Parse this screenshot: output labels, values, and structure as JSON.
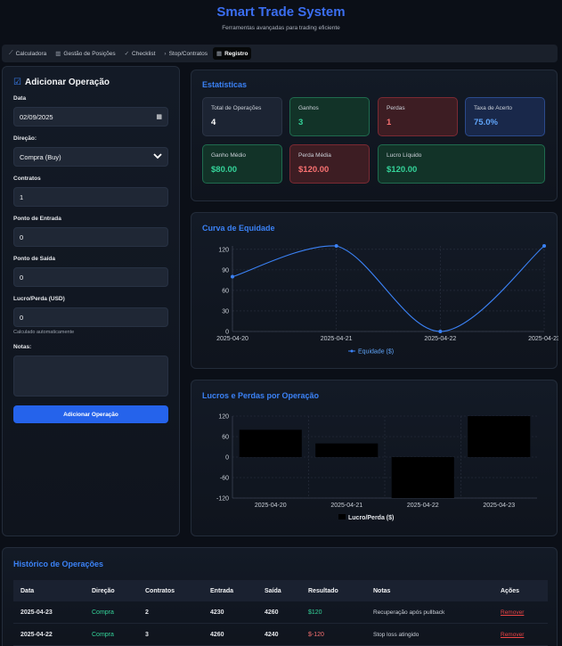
{
  "app": {
    "title": "Smart Trade System",
    "subtitle": "Ferramentas avançadas para trading eficiente"
  },
  "tabs": [
    {
      "label": "Calculadora",
      "icon": "trend-icon",
      "active": false
    },
    {
      "label": "Gestão de Posições",
      "icon": "bar-chart-icon",
      "active": false
    },
    {
      "label": "Checklist",
      "icon": "check-icon",
      "active": false
    },
    {
      "label": "Stop/Contratos",
      "icon": "chevron-icon",
      "active": false
    },
    {
      "label": "Registro",
      "icon": "calendar-icon",
      "active": true
    }
  ],
  "form": {
    "title": "Adicionar Operação",
    "date_label": "Data",
    "date_value": "02/09/2025",
    "direction_label": "Direção:",
    "direction_value": "Compra (Buy)",
    "contracts_label": "Contratos",
    "contracts_value": "1",
    "entry_label": "Ponto de Entrada",
    "entry_value": "0",
    "exit_label": "Ponto de Saída",
    "exit_value": "0",
    "pnl_label": "Lucro/Perda (USD)",
    "pnl_value": "0",
    "pnl_hint": "Calculado automaticamente",
    "notes_label": "Notas:",
    "notes_value": "",
    "submit_label": "Adicionar Operação"
  },
  "stats": {
    "title": "Estatísticas",
    "cards": [
      {
        "label": "Total de Operações",
        "value": "4",
        "tone": "neutral"
      },
      {
        "label": "Ganhos",
        "value": "3",
        "tone": "green"
      },
      {
        "label": "Perdas",
        "value": "1",
        "tone": "red"
      },
      {
        "label": "Taxa de Acerto",
        "value": "75.0%",
        "tone": "blue"
      },
      {
        "label": "Ganho Médio",
        "value": "$80.00",
        "tone": "green"
      },
      {
        "label": "Perda Média",
        "value": "$120.00",
        "tone": "red"
      },
      {
        "label": "Lucro Líquido",
        "value": "$120.00",
        "tone": "green"
      }
    ]
  },
  "equity": {
    "title": "Curva de Equidade",
    "legend": "Equidade ($)"
  },
  "pnl": {
    "title": "Lucros e Perdas por Operação",
    "legend": "Lucro/Perda ($)"
  },
  "chart_data": [
    {
      "type": "line",
      "title": "Curva de Equidade",
      "x": [
        "2025-04-20",
        "2025-04-21",
        "2025-04-22",
        "2025-04-23"
      ],
      "series": [
        {
          "name": "Equidade ($)",
          "values": [
            80,
            125,
            0,
            125
          ]
        }
      ],
      "yticks": [
        0,
        30,
        60,
        90,
        120
      ],
      "ylim": [
        0,
        125
      ],
      "grid": true,
      "legend": "bottom",
      "color": "#3b82f6"
    },
    {
      "type": "bar",
      "title": "Lucros e Perdas por Operação",
      "categories": [
        "2025-04-20",
        "2025-04-21",
        "2025-04-22",
        "2025-04-23"
      ],
      "series": [
        {
          "name": "Lucro/Perda ($)",
          "values": [
            80,
            40,
            -120,
            120
          ]
        }
      ],
      "yticks": [
        120,
        60,
        0,
        -60,
        -120
      ],
      "ylim": [
        -120,
        120
      ],
      "grid": true,
      "legend": "bottom",
      "color": "#000000"
    }
  ],
  "history": {
    "title": "Histórico de Operações",
    "headers": [
      "Data",
      "Direção",
      "Contratos",
      "Entrada",
      "Saída",
      "Resultado",
      "Notas",
      "Ações"
    ],
    "rows": [
      {
        "date": "2025-04-23",
        "direction": "Compra",
        "contracts": "2",
        "entry": "4230",
        "exit": "4260",
        "result": "$120",
        "result_tone": "green",
        "notes": "Recuperação após pullback",
        "action": "Remover"
      },
      {
        "date": "2025-04-22",
        "direction": "Compra",
        "contracts": "3",
        "entry": "4260",
        "exit": "4240",
        "result": "$-120",
        "result_tone": "red",
        "notes": "Stop loss atingido",
        "action": "Remover"
      }
    ]
  }
}
